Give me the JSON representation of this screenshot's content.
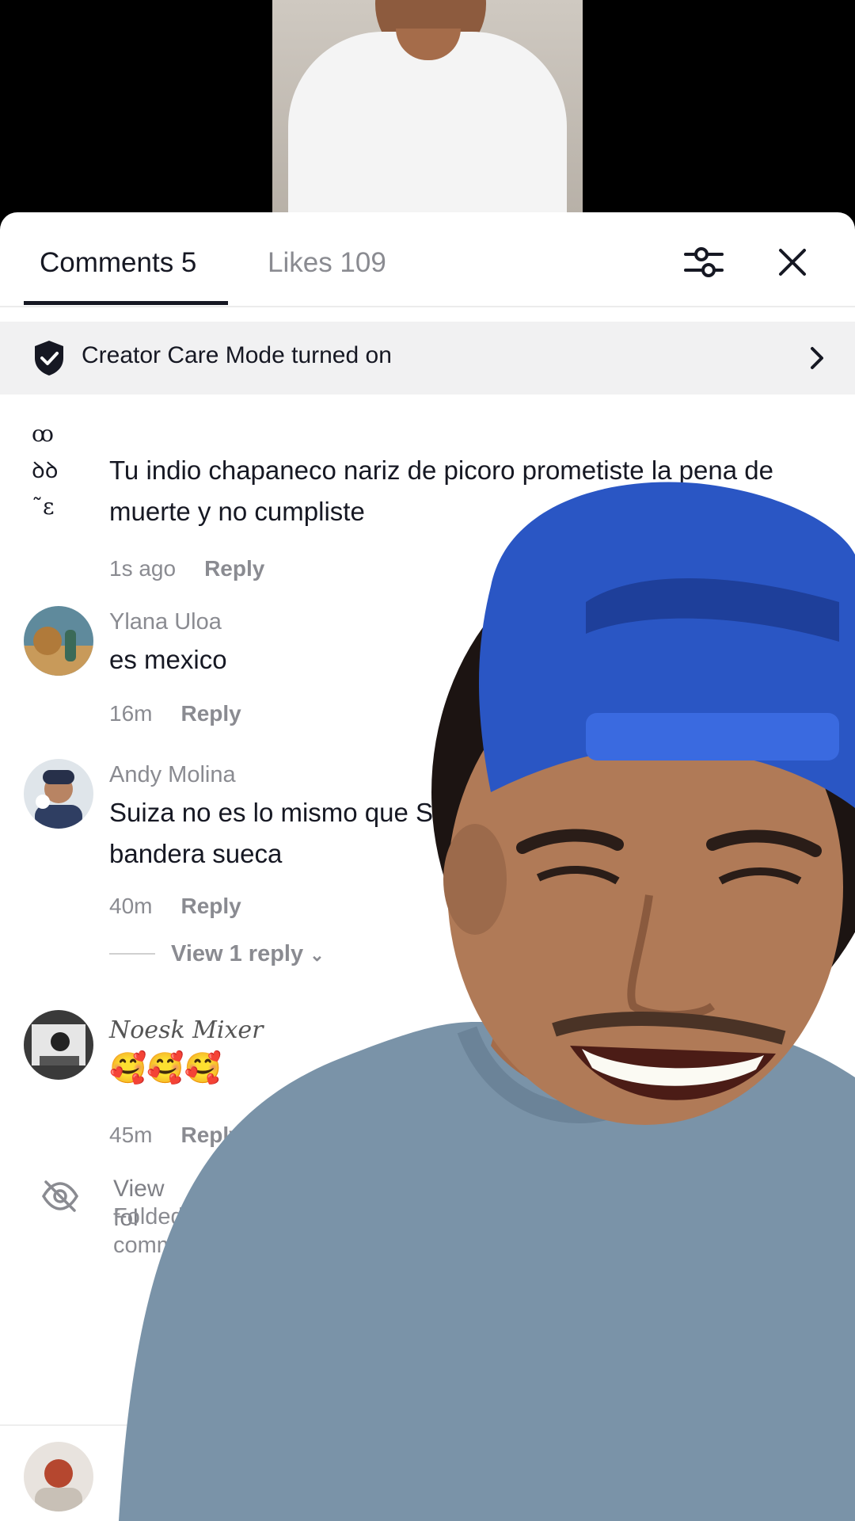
{
  "tabs": {
    "comments_label": "Comments 5",
    "likes_label": "Likes 109"
  },
  "care_mode": {
    "text": "Creator Care Mode turned on"
  },
  "comments": [
    {
      "username": "",
      "text": "Tu indio chapaneco nariz de picoro prometiste la pena de muerte y no cumpliste",
      "time": "1s ago",
      "reply_label": "Reply"
    },
    {
      "username": "Ylana Uloa",
      "text": "es mexico",
      "time": "16m",
      "reply_label": "Reply"
    },
    {
      "username": "Andy Molina",
      "text": "Suiza no es lo mismo que S bandera sueca",
      "time": "40m",
      "reply_label": "Reply",
      "view_replies": "View 1 reply"
    },
    {
      "username": "Noesk Mixer",
      "text": "🥰🥰🥰",
      "time": "45m",
      "reply_label": "Reply"
    }
  ],
  "folded": {
    "title": "View fol",
    "line2": "Folded",
    "line3": "comm"
  },
  "icons": {
    "filter": "filter-sliders-icon",
    "close": "close-icon",
    "care": "shield-check-icon",
    "chevron": "chevron-right-icon",
    "hidden": "eye-off-icon"
  },
  "colors": {
    "text": "#161823",
    "muted": "#8a8b91",
    "cap": "#2a56c4",
    "shirt": "#7a93a8"
  }
}
